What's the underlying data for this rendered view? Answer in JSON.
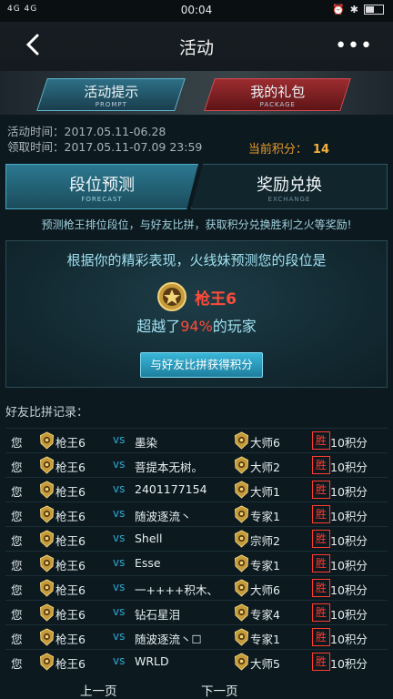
{
  "status_bar": {
    "signal_left": "4G 4G",
    "time": "00:04"
  },
  "header": {
    "title": "活动",
    "more": "•••"
  },
  "banner": {
    "tabs": [
      {
        "label": "活动提示",
        "sub": "PROMPT"
      },
      {
        "label": "我的礼包",
        "sub": "PACKAGE"
      }
    ]
  },
  "info": {
    "activity_time": "活动时间：2017.05.11-06.28",
    "claim_time": "领取时间：2017.05.11-07.09 23:59",
    "score_label": "当前积分：",
    "score_value": "14"
  },
  "tabs": [
    {
      "label": "段位预测",
      "sub": "FORECAST"
    },
    {
      "label": "奖励兑换",
      "sub": "EXCHANGE"
    }
  ],
  "description": "预测枪王排位段位，与好友比拼，获取积分兑换胜利之火等奖励!",
  "forecast": {
    "line1": "根据你的精彩表现，火线妹预测您的段位是",
    "rank": "枪王6",
    "beat_prefix": "超越了",
    "beat_pct": "94%",
    "beat_suffix": "的玩家",
    "button": "与好友比拼获得积分"
  },
  "records": {
    "title": "好友比拼记录：",
    "rows": [
      {
        "you": "您",
        "my_rank": "枪王6",
        "vs": "vs",
        "friend": "墨染",
        "friend_rank": "大师6",
        "result": "胜",
        "points": "10积分"
      },
      {
        "you": "您",
        "my_rank": "枪王6",
        "vs": "vs",
        "friend": "菩提本无树。",
        "friend_rank": "大师2",
        "result": "胜",
        "points": "10积分"
      },
      {
        "you": "您",
        "my_rank": "枪王6",
        "vs": "vs",
        "friend": "2401177154",
        "friend_rank": "大师1",
        "result": "胜",
        "points": "10积分"
      },
      {
        "you": "您",
        "my_rank": "枪王6",
        "vs": "vs",
        "friend": "随波逐流丶",
        "friend_rank": "专家1",
        "result": "胜",
        "points": "10积分"
      },
      {
        "you": "您",
        "my_rank": "枪王6",
        "vs": "vs",
        "friend": "Shell",
        "friend_rank": "宗师2",
        "result": "胜",
        "points": "10积分"
      },
      {
        "you": "您",
        "my_rank": "枪王6",
        "vs": "vs",
        "friend": "Esse",
        "friend_rank": "专家1",
        "result": "胜",
        "points": "10积分"
      },
      {
        "you": "您",
        "my_rank": "枪王6",
        "vs": "vs",
        "friend": "一++++积木、",
        "friend_rank": "大师6",
        "result": "胜",
        "points": "10积分"
      },
      {
        "you": "您",
        "my_rank": "枪王6",
        "vs": "vs",
        "friend": "钻石星泪",
        "friend_rank": "专家4",
        "result": "胜",
        "points": "10积分"
      },
      {
        "you": "您",
        "my_rank": "枪王6",
        "vs": "vs",
        "friend": "随波逐流丶☐",
        "friend_rank": "专家1",
        "result": "胜",
        "points": "10积分"
      },
      {
        "you": "您",
        "my_rank": "枪王6",
        "vs": "vs",
        "friend": "WRLD",
        "friend_rank": "大师5",
        "result": "胜",
        "points": "10积分"
      }
    ]
  },
  "pager": {
    "prev": "上一页",
    "next": "下一页"
  },
  "colors": {
    "accent": "#2fa8d3",
    "win": "#ff3b2f",
    "score": "#f4b13a"
  }
}
